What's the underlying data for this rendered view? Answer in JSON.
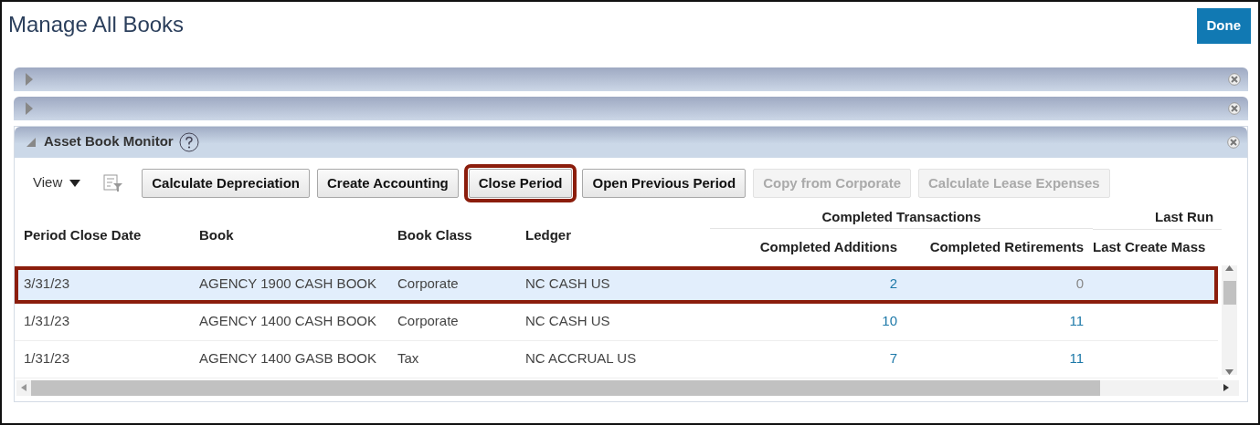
{
  "page": {
    "title": "Manage All Books"
  },
  "done_button": {
    "label": "Done"
  },
  "collapsed_panels": [
    {
      "expanded": false
    },
    {
      "expanded": false
    }
  ],
  "panel": {
    "title": "Asset Book Monitor",
    "expanded": true
  },
  "toolbar": {
    "view_menu": "View",
    "buttons": [
      {
        "label": "Calculate Depreciation",
        "disabled": false,
        "highlighted": false
      },
      {
        "label": "Create Accounting",
        "disabled": false,
        "highlighted": false
      },
      {
        "label": "Close Period",
        "disabled": false,
        "highlighted": true
      },
      {
        "label": "Open Previous Period",
        "disabled": false,
        "highlighted": false
      },
      {
        "label": "Copy from Corporate",
        "disabled": true,
        "highlighted": false
      },
      {
        "label": "Calculate Lease Expenses",
        "disabled": true,
        "highlighted": false
      }
    ]
  },
  "table": {
    "column_groups": [
      {
        "label": "Completed Transactions"
      },
      {
        "label": "Last Run"
      }
    ],
    "columns": [
      "Period Close Date",
      "Book",
      "Book Class",
      "Ledger",
      "Completed Additions",
      "Completed Retirements",
      "Last Create Mass"
    ],
    "rows": [
      {
        "selected": true,
        "highlighted": true,
        "period_close_date": "3/31/23",
        "book": "AGENCY 1900 CASH BOOK",
        "book_class": "Corporate",
        "ledger": "NC CASH US",
        "completed_additions": {
          "text": "2",
          "link": true
        },
        "completed_retirements": {
          "text": "0",
          "link": false
        }
      },
      {
        "selected": false,
        "highlighted": false,
        "period_close_date": "1/31/23",
        "book": "AGENCY 1400 CASH BOOK",
        "book_class": "Corporate",
        "ledger": "NC CASH US",
        "completed_additions": {
          "text": "10",
          "link": true
        },
        "completed_retirements": {
          "text": "11",
          "link": true
        }
      },
      {
        "selected": false,
        "highlighted": false,
        "period_close_date": "1/31/23",
        "book": "AGENCY 1400 GASB BOOK",
        "book_class": "Tax",
        "ledger": "NC ACCRUAL US",
        "completed_additions": {
          "text": "7",
          "link": true
        },
        "completed_retirements": {
          "text": "11",
          "link": true
        }
      }
    ]
  }
}
